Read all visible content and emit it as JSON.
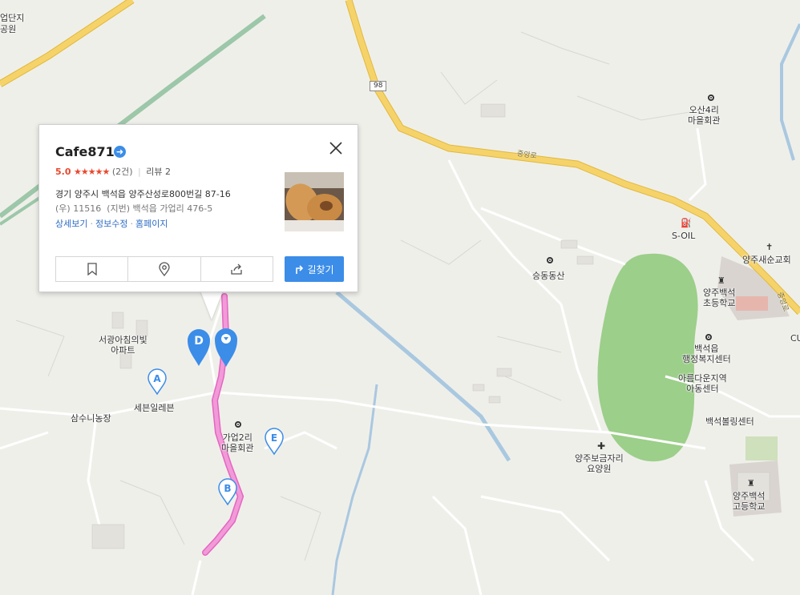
{
  "place": {
    "name": "Cafe8716",
    "rating_score": "5.0",
    "rating_stars": "★★★★★",
    "rating_count": "(2건)",
    "review_label": "리뷰 2",
    "address_road": "경기 양주시 백석읍 양주산성로800번길 87-16",
    "address_postal": "(우) 11516",
    "address_lot_label": "(지번)",
    "address_lot": "백석읍 가업리 476-5",
    "links": [
      "상세보기",
      "정보수정",
      "홈페이지"
    ],
    "route_label": "길찾기",
    "actions": [
      "bookmark-icon",
      "pin-icon",
      "share-icon"
    ]
  },
  "labels": {
    "apt_complex_top": "업단지",
    "park_top": "공원",
    "osan_hall": "오산4리\n마을회관",
    "soil": "S-OIL",
    "church": "양주새순교회",
    "elementary": "양주백석\n초등학교",
    "welfare_center": "백석읍\n행정복지센터",
    "childcare": "아름다운지역\n아동센터",
    "bowling": "백석볼링센터",
    "high_school": "양주백석\n고등학교",
    "nursing": "양주보금자리\n요양원",
    "mountain": "승동동산",
    "gaeop_hall": "가업2리\n마을회관",
    "samsuni_farm": "삼수니농장",
    "seven_eleven": "세븐일레븐",
    "apartment": "서광아침의빛\n아파트",
    "cu_partial": "CU",
    "route_98": "98",
    "road_jungang": "중앙로",
    "road_partial": "중앙로"
  },
  "markers": [
    "A",
    "B",
    "D",
    "E"
  ],
  "colors": {
    "accent": "#3b8de8",
    "rating": "#e8482e",
    "route": "#f19ad8",
    "highway": "#f6d36a",
    "park": "#9ccf8a",
    "water": "#a9c8e0"
  }
}
